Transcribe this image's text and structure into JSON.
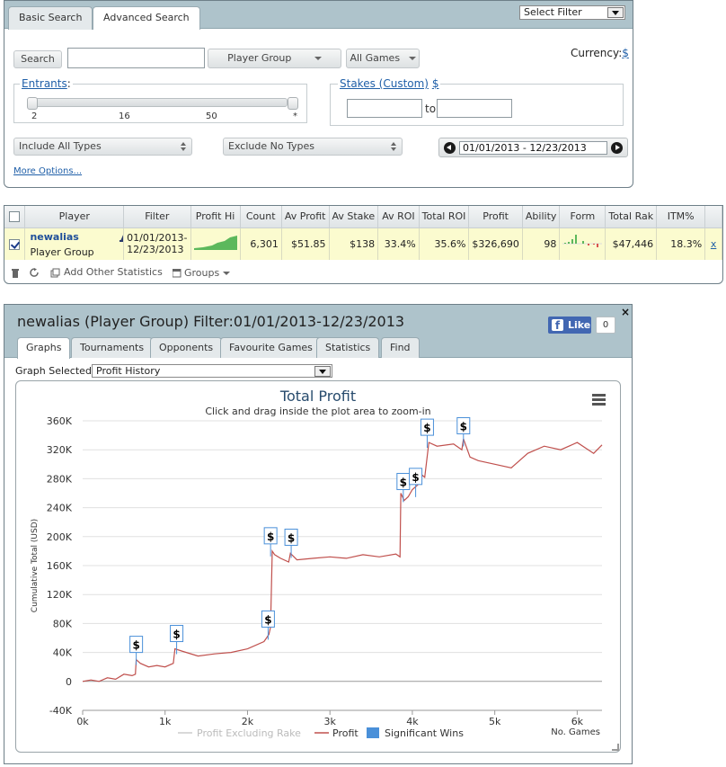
{
  "search": {
    "tabs": [
      "Basic Search",
      "Advanced Search"
    ],
    "select_filter": "Select Filter",
    "search_btn": "Search",
    "player_group": "Player Group",
    "all_games": "All Games",
    "currency_label": "Currency:",
    "currency_value": "$",
    "entrants_label": "Entrants",
    "entrants_colon": ":",
    "entrants_ticks": [
      "2",
      "16",
      "50",
      "*"
    ],
    "stakes_label": "Stakes (Custom)",
    "stakes_currency": "$",
    "stakes_to": "to",
    "include_types": "Include All Types",
    "exclude_types": "Exclude No Types",
    "date_range": "01/01/2013 - 12/23/2013",
    "more_options": "More Options..."
  },
  "results": {
    "headers": [
      "Player",
      "Filter",
      "Profit Hi",
      "Count",
      "Av Profit",
      "Av Stake",
      "Av ROI",
      "Total ROI",
      "Profit",
      "Ability",
      "Form",
      "Total Rak",
      "ITM%"
    ],
    "row": {
      "player_name": "newalias",
      "player_type": "Player Group",
      "filter_line1": "01/01/2013-",
      "filter_line2": "12/23/2013",
      "count": "6,301",
      "av_profit": "$51.85",
      "av_stake": "$138",
      "av_roi": "33.4%",
      "total_roi": "35.6%",
      "profit": "$326,690",
      "ability": "98",
      "total_rake": "$47,446",
      "itm": "18.3%",
      "remove": "x"
    },
    "footer": {
      "add_stats": "Add Other Statistics",
      "groups": "Groups"
    }
  },
  "graph_panel": {
    "title": "newalias (Player Group) Filter:01/01/2013-12/23/2013",
    "fb_like": "Like",
    "fb_count": "0",
    "close": "×",
    "tabs": [
      "Graphs",
      "Tournaments",
      "Opponents",
      "Favourite Games",
      "Statistics",
      "Find"
    ],
    "graph_selected_label": "Graph Selected:",
    "graph_selected_value": "Profit History"
  },
  "chart_data": {
    "type": "line",
    "title": "Total Profit",
    "subtitle": "Click and drag inside the plot area to zoom-in",
    "ylabel": "Cumulative Total (USD)",
    "xlabel": "No. Games",
    "ylim": [
      -40000,
      360000
    ],
    "xlim": [
      0,
      6301
    ],
    "y_ticks": [
      "-40K",
      "0",
      "40K",
      "80K",
      "120K",
      "160K",
      "200K",
      "240K",
      "280K",
      "320K",
      "360K"
    ],
    "x_ticks": [
      "0k",
      "1k",
      "2k",
      "3k",
      "4k",
      "5k",
      "6k"
    ],
    "legend": [
      "Profit Excluding Rake",
      "Profit",
      "Significant Wins"
    ],
    "legend_position": "bottom",
    "colors": {
      "profit": "#c0504d",
      "excl_rake": "#cccccc",
      "sig_wins": "#4a90d9"
    },
    "series": [
      {
        "name": "Profit",
        "x": [
          0,
          100,
          200,
          300,
          400,
          500,
          600,
          640,
          650,
          700,
          800,
          900,
          1000,
          1100,
          1120,
          1200,
          1400,
          1600,
          1800,
          2000,
          2200,
          2230,
          2260,
          2280,
          2300,
          2330,
          2400,
          2500,
          2520,
          2600,
          2800,
          3000,
          3200,
          3400,
          3600,
          3800,
          3850,
          3860,
          3900,
          3950,
          4000,
          4100,
          4120,
          4150,
          4200,
          4300,
          4500,
          4600,
          4620,
          4700,
          4800,
          5000,
          5200,
          5400,
          5600,
          5800,
          6000,
          6200,
          6301
        ],
        "values": [
          0,
          2000,
          0,
          5000,
          3000,
          10000,
          8000,
          10000,
          30000,
          25000,
          20000,
          22000,
          20000,
          25000,
          45000,
          42000,
          35000,
          38000,
          40000,
          45000,
          55000,
          60000,
          65000,
          75000,
          180000,
          175000,
          170000,
          165000,
          177000,
          168000,
          170000,
          172000,
          170000,
          175000,
          172000,
          176000,
          172000,
          260000,
          250000,
          255000,
          265000,
          275000,
          285000,
          282000,
          330000,
          325000,
          328000,
          320000,
          335000,
          310000,
          305000,
          300000,
          295000,
          315000,
          325000,
          320000,
          330000,
          315000,
          326690
        ]
      }
    ],
    "significant_wins": [
      {
        "x": 650,
        "y": 40000
      },
      {
        "x": 1140,
        "y": 55000
      },
      {
        "x": 2250,
        "y": 75000
      },
      {
        "x": 2280,
        "y": 190000
      },
      {
        "x": 2530,
        "y": 188000
      },
      {
        "x": 3890,
        "y": 265000
      },
      {
        "x": 4040,
        "y": 272000
      },
      {
        "x": 4180,
        "y": 340000
      },
      {
        "x": 4620,
        "y": 342000
      }
    ]
  }
}
